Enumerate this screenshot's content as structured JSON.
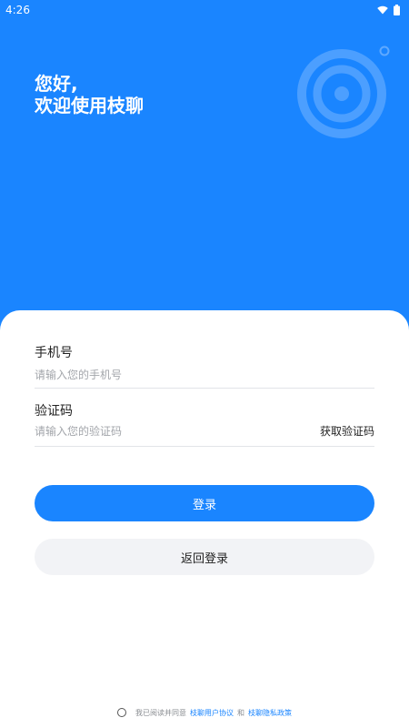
{
  "status_bar": {
    "time": "4:26",
    "wifi_icon": "wifi-icon",
    "battery_icon": "battery-icon"
  },
  "hero": {
    "greeting": "您好,",
    "welcome": "欢迎使用枝聊",
    "decoration_icon": "target-chat-icon"
  },
  "form": {
    "phone_label": "手机号",
    "phone_placeholder": "请输入您的手机号",
    "code_label": "验证码",
    "code_placeholder": "请输入您的验证码",
    "get_code": "获取验证码"
  },
  "buttons": {
    "login": "登录",
    "back_login": "返回登录"
  },
  "agreement": {
    "prefix": "我已阅读并同意",
    "user_agreement": "枝聊用户协议",
    "and": "和",
    "privacy_policy": "枝聊隐私政策"
  },
  "colors": {
    "primary": "#1a85ff",
    "secondary_button": "#f2f3f6"
  }
}
